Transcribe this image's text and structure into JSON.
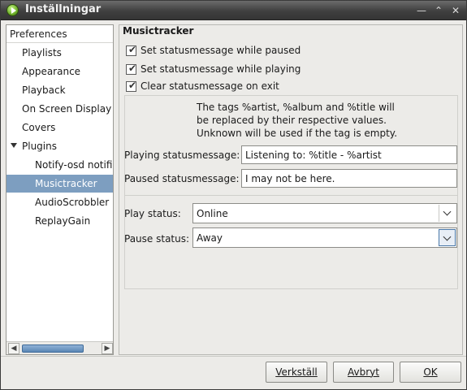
{
  "window": {
    "title": "Inställningar"
  },
  "sidebar": {
    "header": "Preferences",
    "items": [
      {
        "label": "Playlists"
      },
      {
        "label": "Appearance"
      },
      {
        "label": "Playback"
      },
      {
        "label": "On Screen Display"
      },
      {
        "label": "Covers"
      },
      {
        "label": "Plugins"
      },
      {
        "label": "Notify-osd notific"
      },
      {
        "label": "Musictracker",
        "selected": true
      },
      {
        "label": "AudioScrobbler"
      },
      {
        "label": "ReplayGain"
      }
    ]
  },
  "main": {
    "section_title": "Musictracker",
    "checkboxes": [
      {
        "label": "Set statusmessage while paused",
        "checked": true
      },
      {
        "label": "Set statusmessage while playing",
        "checked": true
      },
      {
        "label": "Clear statusmessage on exit",
        "checked": true
      }
    ],
    "info_lines": [
      "The tags %artist, %album and %title will",
      "be replaced by their respective values.",
      "Unknown will be used if the tag is empty."
    ],
    "playing_label": "Playing statusmessage:",
    "playing_value": "Listening to: %title - %artist",
    "paused_label": "Paused statusmessage:",
    "paused_value": "I may not be here.",
    "play_status_label": "Play status:",
    "play_status_value": "Online",
    "pause_status_label": "Pause status:",
    "pause_status_value": "Away"
  },
  "buttons": {
    "apply": "Verkställ",
    "cancel": "Avbryt",
    "ok": "OK"
  }
}
